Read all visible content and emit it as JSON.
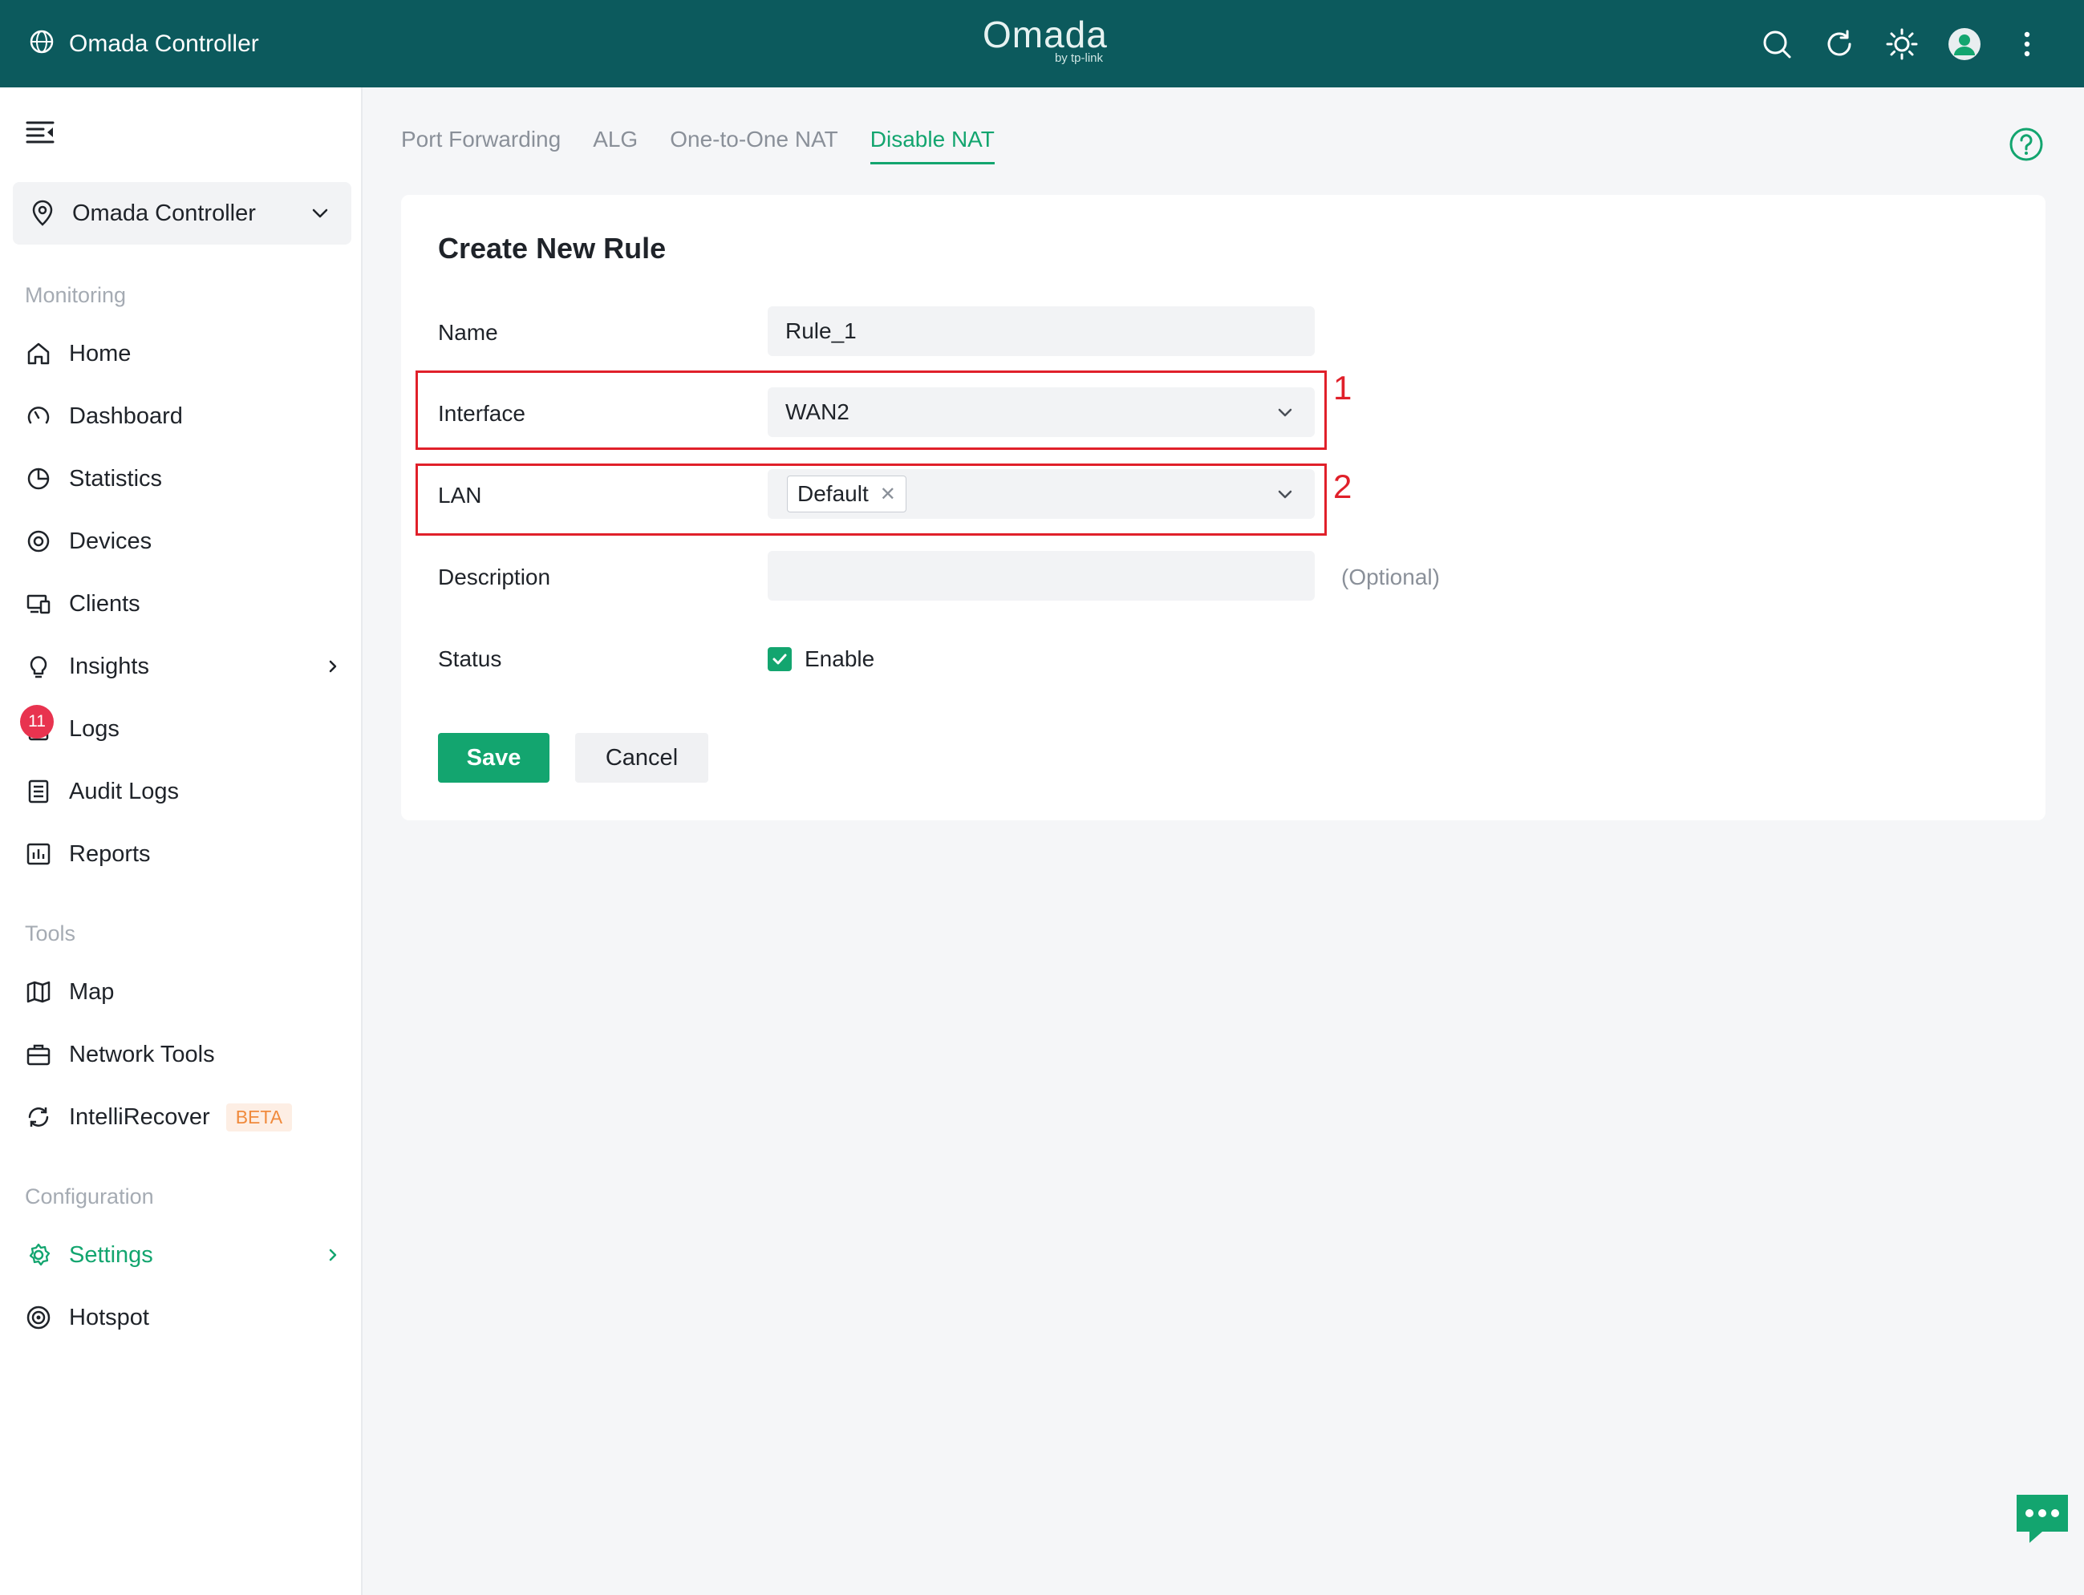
{
  "app": {
    "title": "Omada Controller",
    "logo_text": "Omada",
    "logo_sub": "by tp-link"
  },
  "topbar_icons": [
    "search-icon",
    "refresh-icon",
    "theme-sun-icon",
    "avatar",
    "more-vertical-icon"
  ],
  "sidebar": {
    "site": "Omada Controller",
    "sections": {
      "monitoring": "Monitoring",
      "tools": "Tools",
      "configuration": "Configuration"
    },
    "items": [
      {
        "label": "Home",
        "icon": "home-icon"
      },
      {
        "label": "Dashboard",
        "icon": "dashboard-icon"
      },
      {
        "label": "Statistics",
        "icon": "pie-chart-icon"
      },
      {
        "label": "Devices",
        "icon": "devices-icon"
      },
      {
        "label": "Clients",
        "icon": "clients-icon"
      },
      {
        "label": "Insights",
        "icon": "lightbulb-icon"
      },
      {
        "label": "Logs",
        "icon": "logs-icon",
        "badge": "11"
      },
      {
        "label": "Audit Logs",
        "icon": "audit-logs-icon"
      },
      {
        "label": "Reports",
        "icon": "reports-icon"
      },
      {
        "label": "Map",
        "icon": "map-icon"
      },
      {
        "label": "Network Tools",
        "icon": "toolbox-icon"
      },
      {
        "label": "IntelliRecover",
        "icon": "recover-icon",
        "tag": "BETA"
      },
      {
        "label": "Settings",
        "icon": "gear-icon"
      },
      {
        "label": "Hotspot",
        "icon": "hotspot-icon"
      }
    ]
  },
  "tabs": [
    "Port Forwarding",
    "ALG",
    "One-to-One NAT",
    "Disable NAT"
  ],
  "active_tab": "Disable NAT",
  "form": {
    "title": "Create New Rule",
    "name_label": "Name",
    "name_value": "Rule_1",
    "interface_label": "Interface",
    "interface_value": "WAN2",
    "lan_label": "LAN",
    "lan_tag": "Default",
    "description_label": "Description",
    "description_value": "",
    "description_hint": "(Optional)",
    "status_label": "Status",
    "status_checkbox": "Enable",
    "status_checked": true,
    "save": "Save",
    "cancel": "Cancel"
  },
  "annotations": [
    "1",
    "2"
  ],
  "colors": {
    "topbar": "#0c5a5d",
    "accent": "#13a56f",
    "annotation": "#e0202a",
    "badge": "#e8334f"
  }
}
